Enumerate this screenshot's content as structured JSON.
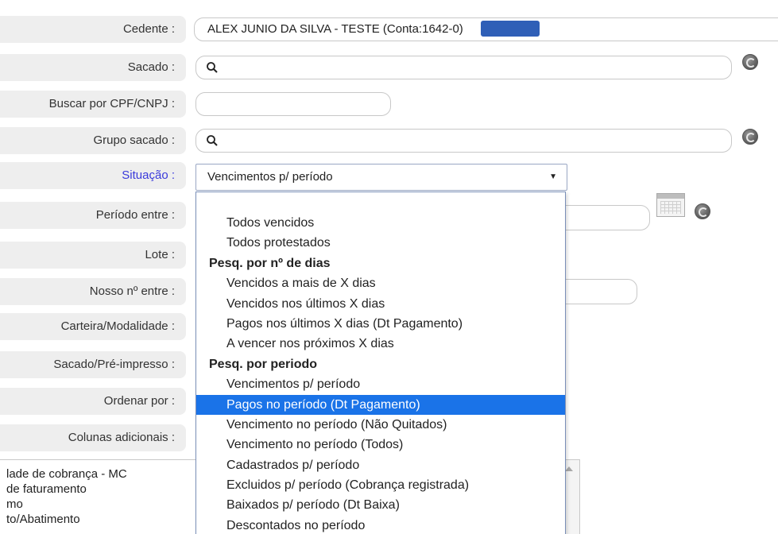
{
  "form": {
    "cedente": {
      "label": "Cedente :",
      "value": "ALEX JUNIO DA SILVA - TESTE (Conta:1642-0)"
    },
    "sacado": {
      "label": "Sacado :"
    },
    "cpf": {
      "label": "Buscar por CPF/CNPJ :"
    },
    "grupo": {
      "label": "Grupo sacado :"
    },
    "situacao": {
      "label": "Situação :",
      "selected": "Vencimentos p/ período"
    },
    "periodo": {
      "label": "Período entre :"
    },
    "lote": {
      "label": "Lote :"
    },
    "nosso": {
      "label": "Nosso nº entre :"
    },
    "carteira": {
      "label": "Carteira/Modalidade :"
    },
    "preimpresso": {
      "label": "Sacado/Pré-impresso :"
    },
    "ordenar": {
      "label": "Ordenar por :"
    },
    "colunas": {
      "label": "Colunas adicionais :"
    }
  },
  "dropdown": {
    "items": [
      {
        "label": "Todos vencidos",
        "type": "option"
      },
      {
        "label": "Todos protestados",
        "type": "option"
      },
      {
        "label": "Pesq. por nº de dias",
        "type": "group"
      },
      {
        "label": "Vencidos a mais de X dias",
        "type": "option"
      },
      {
        "label": "Vencidos nos últimos X dias",
        "type": "option"
      },
      {
        "label": "Pagos nos últimos X dias (Dt Pagamento)",
        "type": "option"
      },
      {
        "label": "A vencer nos próximos X dias",
        "type": "option"
      },
      {
        "label": "Pesq. por periodo",
        "type": "group"
      },
      {
        "label": "Vencimentos p/ período",
        "type": "option"
      },
      {
        "label": "Pagos no período (Dt Pagamento)",
        "type": "option",
        "highlighted": true
      },
      {
        "label": "Vencimento no período (Não Quitados)",
        "type": "option"
      },
      {
        "label": "Vencimento no período (Todos)",
        "type": "option"
      },
      {
        "label": "Cadastrados p/ período",
        "type": "option"
      },
      {
        "label": "Excluidos p/ período (Cobrança registrada)",
        "type": "option"
      },
      {
        "label": "Baixados p/ período (Dt Baixa)",
        "type": "option"
      },
      {
        "label": "Descontados no período",
        "type": "option"
      }
    ]
  },
  "additional_columns": {
    "items": [
      "lade de cobrança - MC",
      "de faturamento",
      "mo",
      "to/Abatimento"
    ]
  },
  "colors": {
    "label_bg": "#eeeeee",
    "highlight": "#1a73e8",
    "situacao_label": "#3a3adb"
  }
}
